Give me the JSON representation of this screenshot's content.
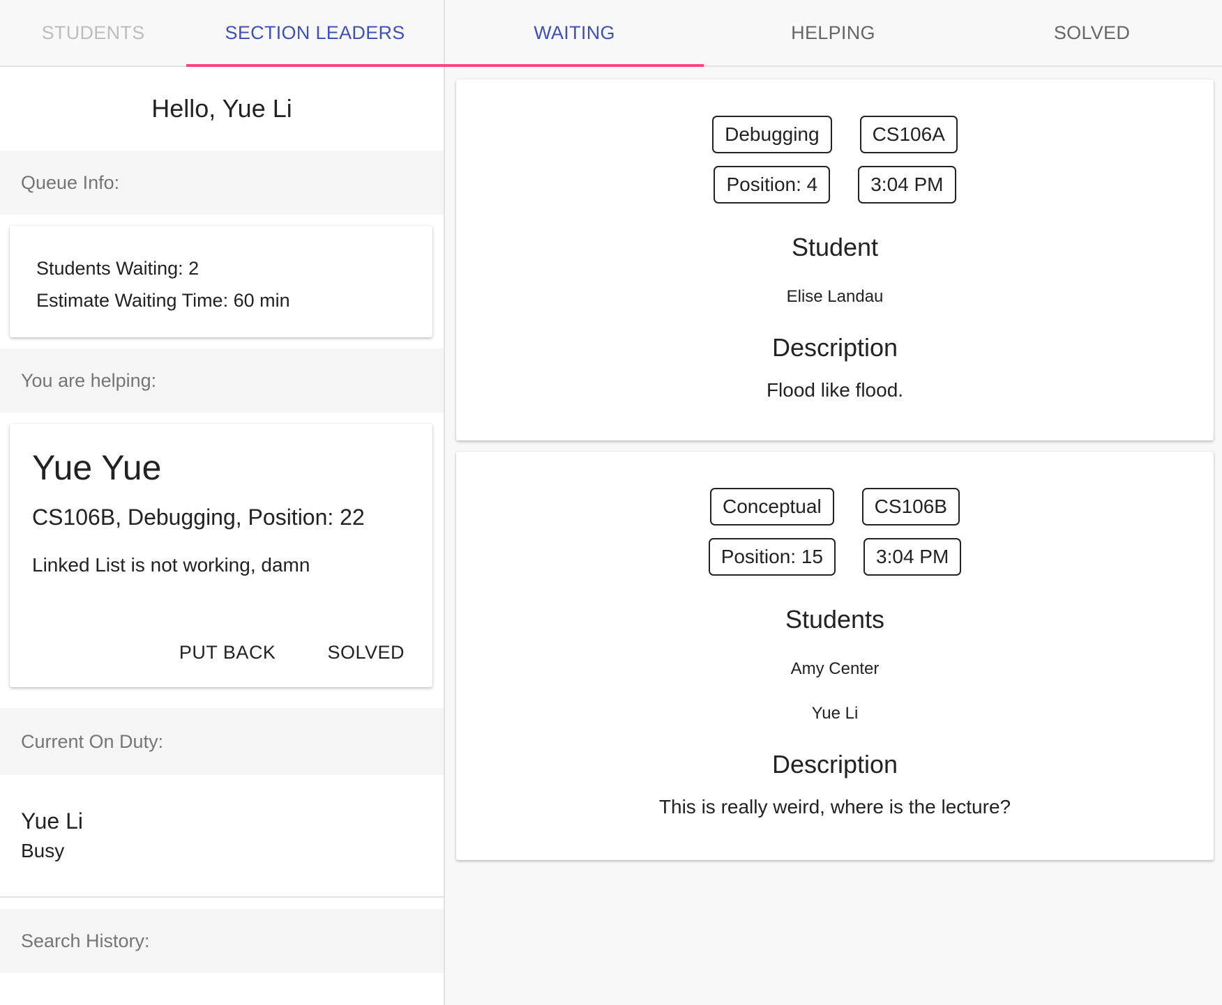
{
  "left": {
    "tabs": [
      {
        "label": "STUDENTS"
      },
      {
        "label": "SECTION LEADERS"
      }
    ],
    "greeting": "Hello, Yue Li",
    "queue_info": {
      "header": "Queue Info:",
      "students_waiting": "Students Waiting: 2",
      "estimate": "Estimate Waiting Time: 60 min"
    },
    "helping": {
      "header": "You are helping:",
      "name": "Yue Yue",
      "meta": "CS106B, Debugging,  Position: 22",
      "description": "Linked List is not working, damn",
      "put_back_label": "PUT BACK",
      "solved_label": "SOLVED"
    },
    "on_duty": {
      "header": "Current On Duty:",
      "name": "Yue Li",
      "status": "Busy"
    },
    "search_history": {
      "header": "Search History:"
    }
  },
  "right": {
    "tabs": [
      {
        "label": "WAITING"
      },
      {
        "label": "HELPING"
      },
      {
        "label": "SOLVED"
      }
    ],
    "requests": [
      {
        "type": "Debugging",
        "course": "CS106A",
        "position": "Position: 4",
        "time": "3:04 PM",
        "students_heading": "Student",
        "students": [
          "Elise Landau"
        ],
        "description_heading": "Description",
        "description": "Flood like flood."
      },
      {
        "type": "Conceptual",
        "course": "CS106B",
        "position": "Position: 15",
        "time": "3:04 PM",
        "students_heading": "Students",
        "students": [
          "Amy Center",
          "Yue Li"
        ],
        "description_heading": "Description",
        "description": "This is really weird, where is the lecture?"
      }
    ]
  },
  "colors": {
    "accent_tab": "#3f51b5",
    "tab_indicator": "#ff4081",
    "section_header_bg": "#f5f5f5"
  }
}
